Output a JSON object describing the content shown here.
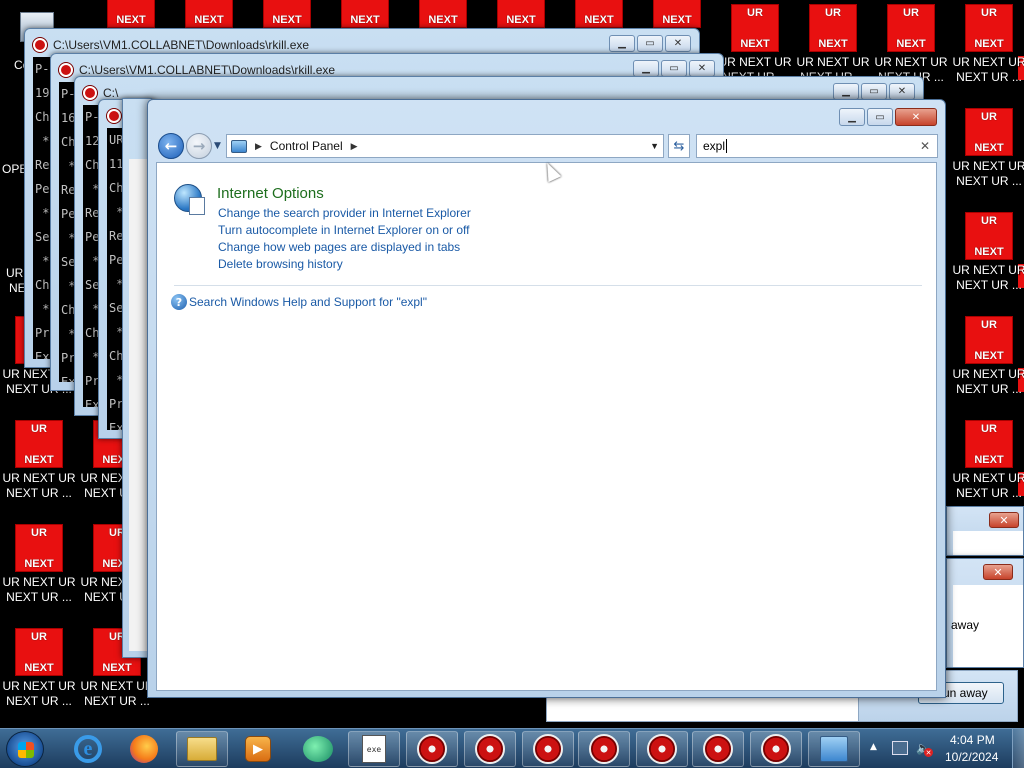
{
  "desktop": {
    "icon_top": "UR",
    "icon_bottom": "NEXT",
    "label_line1": "UR NEXT UR",
    "label_line2": "NEXT UR ...",
    "accent_color": "#e81010",
    "partial_icon_label": "Co",
    "partial_ope": "OPE",
    "partial_ur": "UR",
    "partial_ne": "NE"
  },
  "console_windows": [
    {
      "title": "C:\\Users\\VM1.COLLABNET\\Downloads\\rkill.exe",
      "lines": [
        "P-",
        "19",
        "Ch",
        " *",
        "Re",
        "Pe",
        " *",
        "Se",
        " *",
        "Ch",
        " *",
        "Pr",
        "Ex"
      ]
    },
    {
      "title": "C:\\Users\\VM1.COLLABNET\\Downloads\\rkill.exe",
      "lines": [
        "P-",
        "16",
        "Ch",
        " *",
        "Re",
        "Pe",
        " *",
        "Se",
        " *",
        "Ch",
        " *",
        "Pr",
        "Ex"
      ]
    },
    {
      "title": "C:\\",
      "lines": [
        "P-",
        "12",
        "Ch",
        " *",
        "Re",
        "Pe",
        " *",
        "Se",
        " *",
        "Ch",
        " *",
        "Pr",
        "Ex"
      ]
    },
    {
      "title": "",
      "lines": [
        "UR",
        "11",
        "Ch",
        " *",
        "Re",
        "Pe",
        " *",
        "Se",
        " *",
        "Ch",
        " *",
        "Pr",
        "Ex"
      ]
    }
  ],
  "control_panel": {
    "address_segment": "Control Panel",
    "search_value": "expl",
    "result_title": "Internet Options",
    "tasks": [
      "Change the search provider in Internet Explorer",
      "Turn autocomplete in Internet Explorer on or off",
      "Change how web pages are displayed in tabs",
      "Delete browsing history"
    ],
    "help_link": "Search Windows Help and Support for \"expl\""
  },
  "dialogs": {
    "away_text": "away",
    "run_away_button": "Run away"
  },
  "taskbar": {
    "clock_time": "4:04 PM",
    "clock_date": "10/2/2024"
  }
}
